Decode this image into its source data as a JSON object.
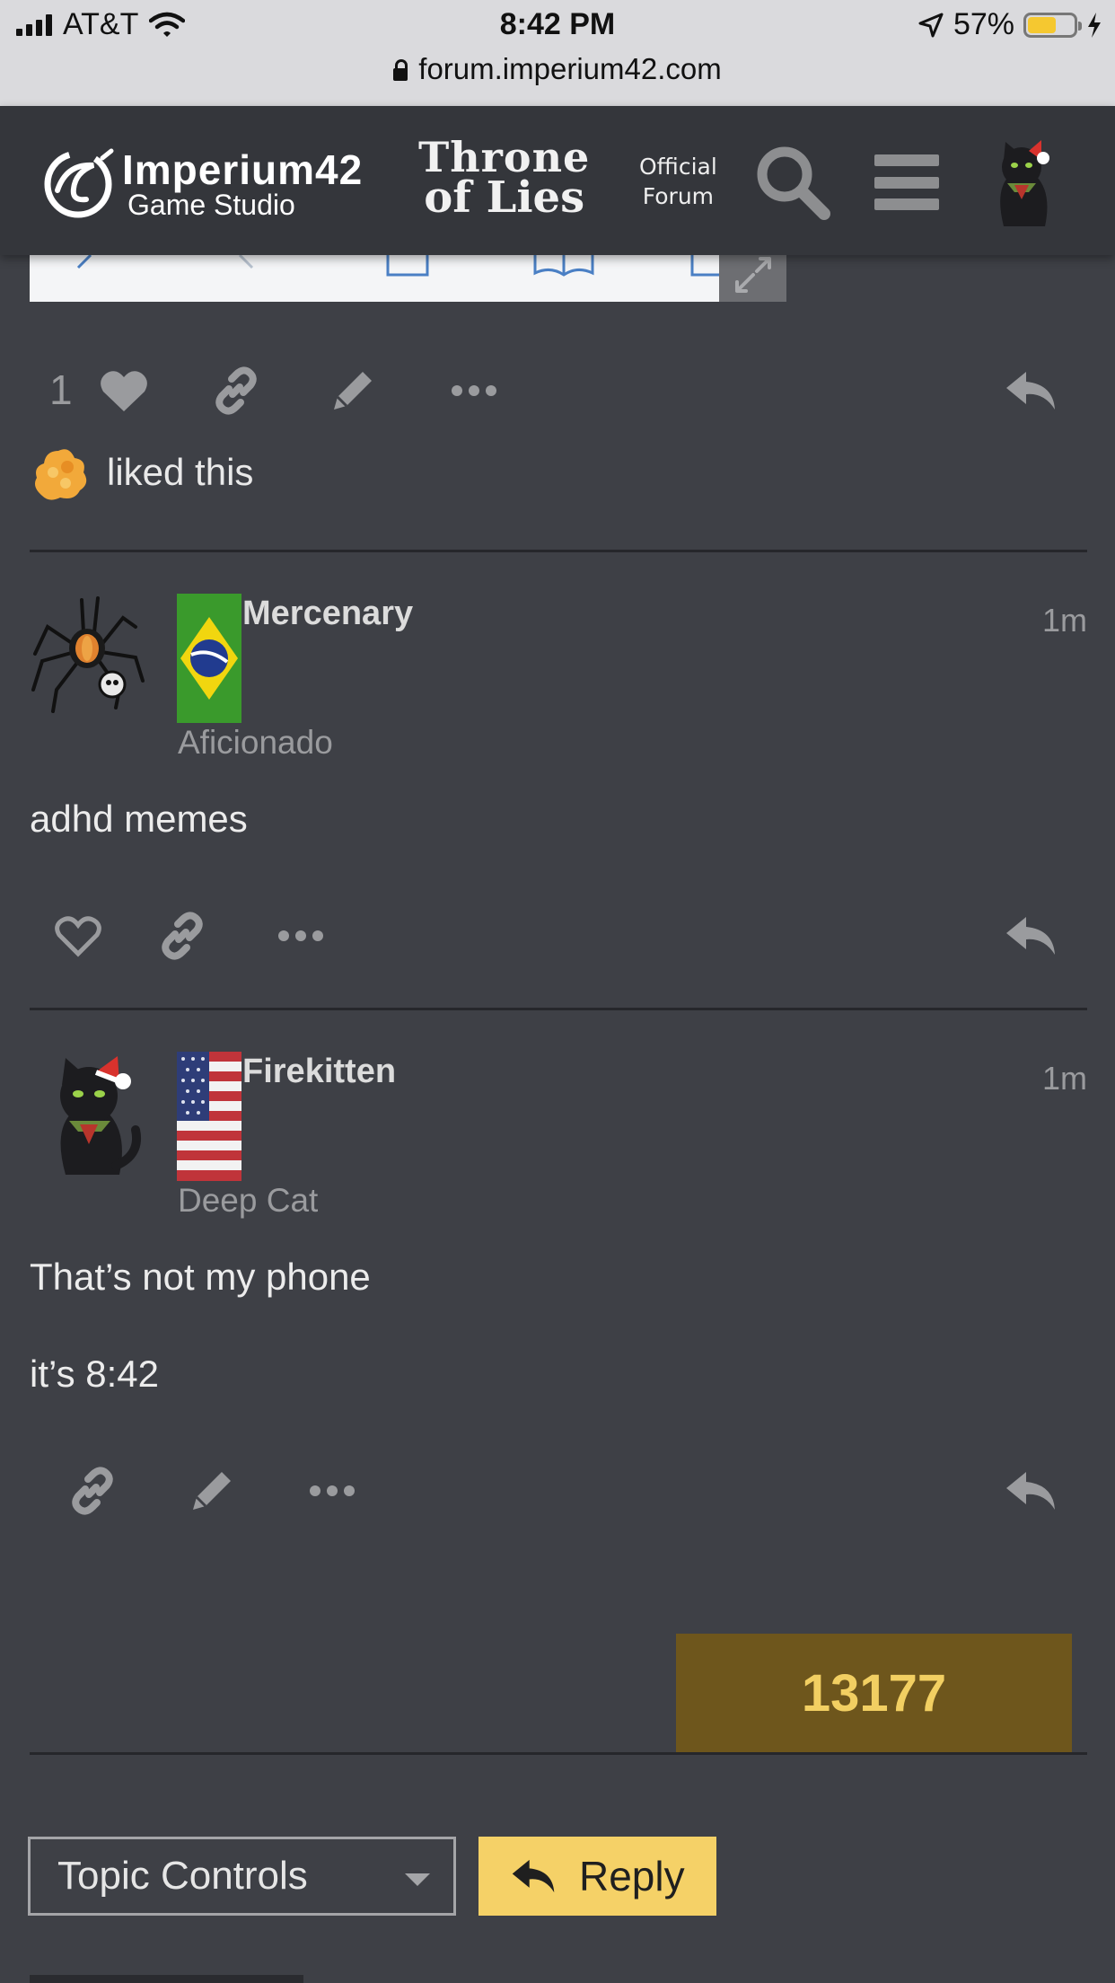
{
  "status_bar": {
    "carrier": "AT&T",
    "time": "8:42 PM",
    "battery": "57%",
    "url": "forum.imperium42.com"
  },
  "header": {
    "brand_name": "Imperium42",
    "brand_sub": "Game Studio",
    "game_line1": "Throne",
    "game_line2": "of Lies",
    "official_line1": "Official",
    "official_line2": "Forum"
  },
  "post0": {
    "like_count": "1",
    "liked_text": "liked this"
  },
  "posts": [
    {
      "username": "Mercenary",
      "user_title": "Aficionado",
      "time": "1m",
      "flag": "brazil",
      "paragraphs": [
        "adhd memes"
      ]
    },
    {
      "username": "Firekitten",
      "user_title": "Deep Cat",
      "time": "1m",
      "flag": "usa",
      "paragraphs": [
        "That’s not my phone",
        "it’s 8:42"
      ]
    }
  ],
  "footer": {
    "progress_number": "13177",
    "topic_controls": "Topic Controls",
    "reply_label": "Reply"
  },
  "colors": {
    "background": "#3e4046",
    "header": "#34363b",
    "reply_button": "#f5d167",
    "progress_box": "#6e561c",
    "progress_text": "#f2cf62"
  }
}
